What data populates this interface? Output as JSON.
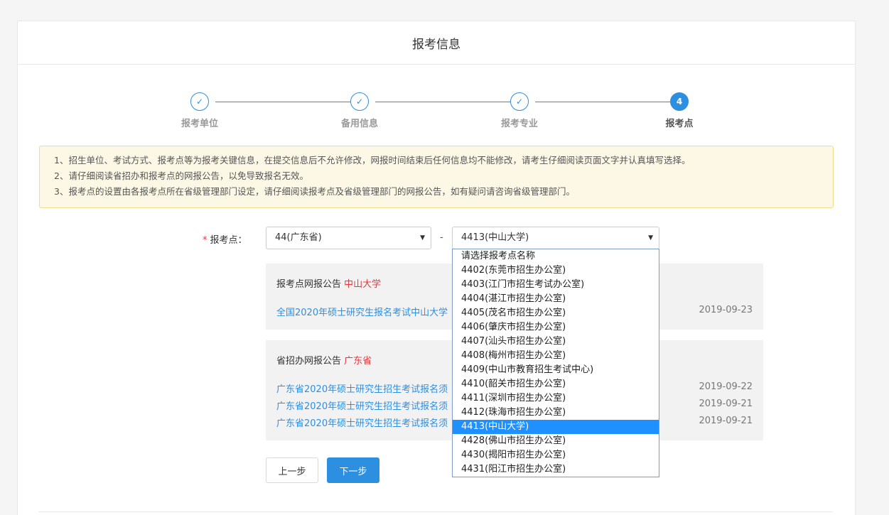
{
  "header": {
    "title": "报考信息"
  },
  "steps": [
    {
      "icon": "check-icon",
      "mark": "✓",
      "label": "报考单位",
      "state": "done"
    },
    {
      "icon": "check-icon",
      "mark": "✓",
      "label": "备用信息",
      "state": "done"
    },
    {
      "icon": "check-icon",
      "mark": "✓",
      "label": "报考专业",
      "state": "done"
    },
    {
      "icon": "number-icon",
      "mark": "4",
      "label": "报考点",
      "state": "active"
    }
  ],
  "notice": {
    "lines": [
      "1、招生单位、考试方式、报考点等为报考关键信息，在提交信息后不允许修改，网报时间结束后任何信息均不能修改，请考生仔细阅读页面文字并认真填写选择。",
      "2、请仔细阅读省招办和报考点的网报公告，以免导致报名无效。",
      "3、报考点的设置由各报考点所在省级管理部门设定，请仔细阅读报考点及省级管理部门的网报公告，如有疑问请咨询省级管理部门。"
    ]
  },
  "form": {
    "required_mark": "*",
    "label": "报考点：",
    "province_value": "44(广东省)",
    "separator": "-",
    "site_value": "4413(中山大学)",
    "arrow": "▼"
  },
  "site_announcement": {
    "title_prefix": "报考点网报公告",
    "title_name": "中山大学",
    "items": [
      {
        "text": "全国2020年硕士研究生报名考试中山大学",
        "date": "2019-09-23"
      }
    ]
  },
  "province_announcement": {
    "title_prefix": "省招办网报公告",
    "title_name": "广东省",
    "items": [
      {
        "text": "广东省2020年硕士研究生招生考试报名须",
        "date": "2019-09-22"
      },
      {
        "text": "广东省2020年硕士研究生招生考试报名须",
        "date": "2019-09-21"
      },
      {
        "text": "广东省2020年硕士研究生招生考试报名须",
        "date": "2019-09-21"
      }
    ]
  },
  "buttons": {
    "prev": "上一步",
    "next": "下一步"
  },
  "dropdown": {
    "options": [
      "请选择报考点名称",
      "4402(东莞市招生办公室)",
      "4403(江门市招生考试办公室)",
      "4404(湛江市招生办公室)",
      "4405(茂名市招生办公室)",
      "4406(肇庆市招生办公室)",
      "4407(汕头市招生办公室)",
      "4408(梅州市招生办公室)",
      "4409(中山市教育招生考试中心)",
      "4410(韶关市招生办公室)",
      "4411(深圳市招生办公室)",
      "4412(珠海市招生办公室)",
      "4413(中山大学)",
      "4428(佛山市招生办公室)",
      "4430(揭阳市招生办公室)",
      "4431(阳江市招生办公室)"
    ],
    "selected": "4413(中山大学)"
  },
  "colors": {
    "primary": "#2d8fe0",
    "required": "#e4393c",
    "notice_bg": "#fdf8e6",
    "selected_bg": "#1e90ff"
  }
}
